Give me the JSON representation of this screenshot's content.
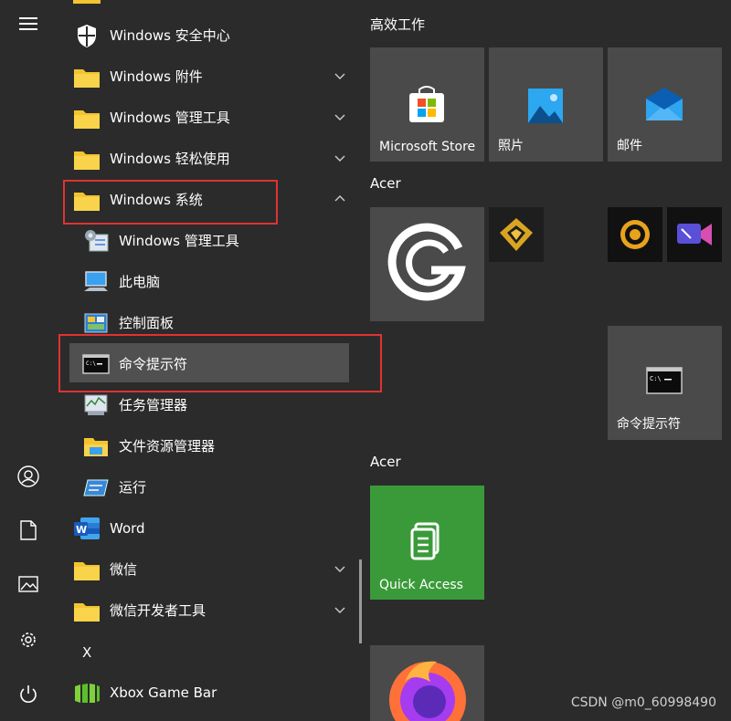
{
  "app_list": {
    "items": [
      {
        "label": "Windows 安全中心",
        "icon": "shield-icon"
      },
      {
        "label": "Windows 附件",
        "icon": "folder-icon",
        "chevron": "down"
      },
      {
        "label": "Windows 管理工具",
        "icon": "folder-icon",
        "chevron": "down"
      },
      {
        "label": "Windows 轻松使用",
        "icon": "folder-icon",
        "chevron": "down"
      },
      {
        "label": "Windows 系统",
        "icon": "folder-icon",
        "chevron": "up"
      },
      {
        "label": "Windows 管理工具",
        "icon": "admin-tools-icon"
      },
      {
        "label": "此电脑",
        "icon": "computer-icon"
      },
      {
        "label": "控制面板",
        "icon": "control-panel-icon"
      },
      {
        "label": "命令提示符",
        "icon": "cmd-icon"
      },
      {
        "label": "任务管理器",
        "icon": "task-manager-icon"
      },
      {
        "label": "文件资源管理器",
        "icon": "file-explorer-icon"
      },
      {
        "label": "运行",
        "icon": "run-icon"
      },
      {
        "label": "Word",
        "icon": "word-icon"
      },
      {
        "label": "微信",
        "icon": "folder-icon",
        "chevron": "down"
      },
      {
        "label": "微信开发者工具",
        "icon": "folder-icon",
        "chevron": "down"
      }
    ],
    "letter_x": "X",
    "xbox": {
      "label": "Xbox Game Bar",
      "icon": "xbox-game-bar-icon"
    }
  },
  "tiles": {
    "group1": "高效工作",
    "store": "Microsoft Store",
    "photos": "照片",
    "mail": "邮件",
    "group2": "Acer",
    "cmd": "命令提示符",
    "group3": "Acer",
    "quick_access": "Quick Access"
  },
  "watermark": "CSDN @m0_60998490",
  "colors": {
    "highlight": "#505050",
    "red_box": "#e03232",
    "quick_access": "#3a9a3a"
  }
}
